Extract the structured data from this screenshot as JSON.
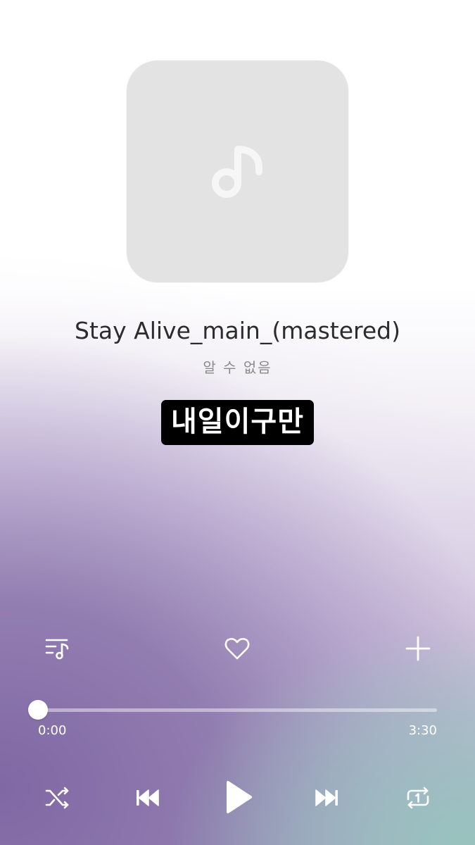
{
  "track": {
    "title": "Stay Alive_main_(mastered)",
    "artist": "알 수 없음"
  },
  "caption": "내일이구만",
  "album_art": {
    "placeholder_icon": "music-note-icon"
  },
  "actions": {
    "queue_icon": "playlist-icon",
    "favorite_icon": "heart-outline-icon",
    "add_icon": "plus-icon"
  },
  "progress": {
    "elapsed": "0:00",
    "duration": "3:30",
    "fraction": 0.0
  },
  "controls": {
    "shuffle_icon": "shuffle-icon",
    "previous_icon": "skip-previous-icon",
    "play_icon": "play-icon",
    "next_icon": "skip-next-icon",
    "repeat_icon": "repeat-one-icon"
  },
  "colors": {
    "album_placeholder": "#e3e3e3",
    "caption_bg": "#000000",
    "accent_purple": "#806aa4",
    "accent_teal": "#96c4be"
  }
}
